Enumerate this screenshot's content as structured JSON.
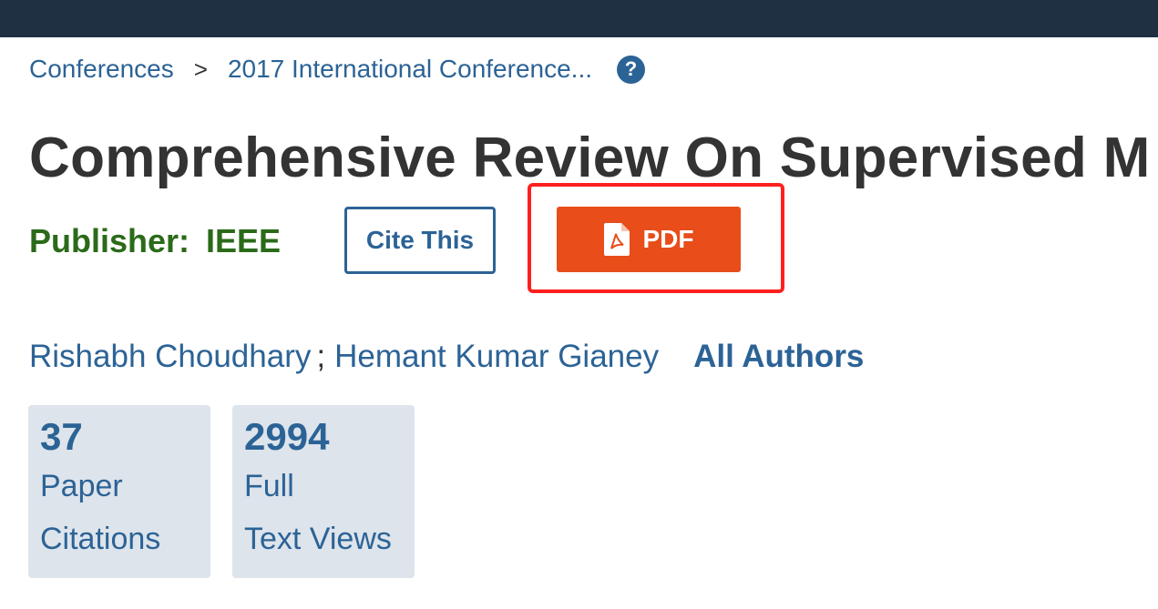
{
  "breadcrumb": {
    "items": [
      "Conferences",
      "2017 International Conference..."
    ],
    "separator": ">",
    "help_icon": "?"
  },
  "article": {
    "title": "Comprehensive Review On Supervised M",
    "publisher_label": "Publisher:",
    "publisher_value": "IEEE"
  },
  "actions": {
    "cite_label": "Cite This",
    "pdf_label": "PDF"
  },
  "authors": {
    "list": [
      "Rishabh Choudhary",
      "Hemant Kumar Gianey"
    ],
    "separator": ";",
    "all_label": "All Authors"
  },
  "metrics": [
    {
      "value": "37",
      "line1": "Paper",
      "line2": "Citations"
    },
    {
      "value": "2994",
      "line1": "Full",
      "line2": "Text Views"
    }
  ],
  "colors": {
    "topbar": "#1f3042",
    "link": "#2c6396",
    "publisher": "#2b6a19",
    "pdf_button": "#e84d1a",
    "highlight": "#ff1f1f",
    "metric_bg": "#dde4eb"
  }
}
